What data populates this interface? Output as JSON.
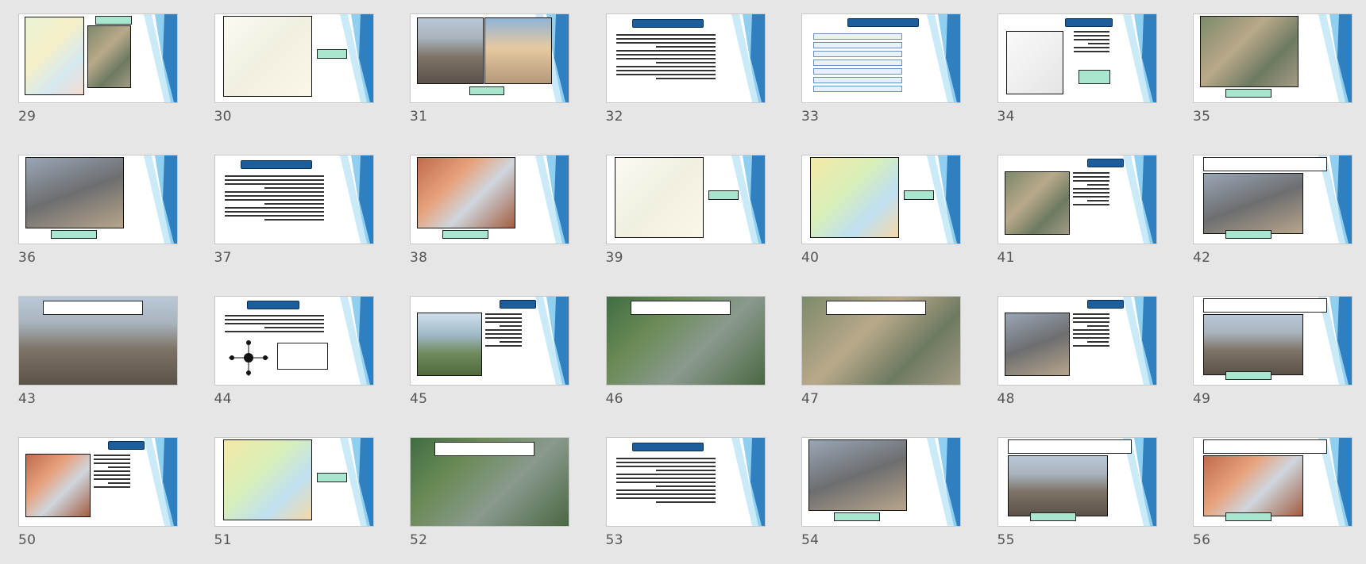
{
  "slides": [
    {
      "number": "29",
      "kind": "map-photo"
    },
    {
      "number": "30",
      "kind": "map"
    },
    {
      "number": "31",
      "kind": "two-photos"
    },
    {
      "number": "32",
      "kind": "text-title"
    },
    {
      "number": "33",
      "kind": "diagram"
    },
    {
      "number": "34",
      "kind": "map-text"
    },
    {
      "number": "35",
      "kind": "photo"
    },
    {
      "number": "36",
      "kind": "photo"
    },
    {
      "number": "37",
      "kind": "text-title"
    },
    {
      "number": "38",
      "kind": "photo"
    },
    {
      "number": "39",
      "kind": "map"
    },
    {
      "number": "40",
      "kind": "map-color"
    },
    {
      "number": "41",
      "kind": "photo-text"
    },
    {
      "number": "42",
      "kind": "photo-caption"
    },
    {
      "number": "43",
      "kind": "full-photo-caption"
    },
    {
      "number": "44",
      "kind": "diagram-text"
    },
    {
      "number": "45",
      "kind": "photo-text"
    },
    {
      "number": "46",
      "kind": "full-photo-caption"
    },
    {
      "number": "47",
      "kind": "full-photo-caption"
    },
    {
      "number": "48",
      "kind": "photo-text"
    },
    {
      "number": "49",
      "kind": "photo-caption"
    },
    {
      "number": "50",
      "kind": "photo-text"
    },
    {
      "number": "51",
      "kind": "map-color"
    },
    {
      "number": "52",
      "kind": "full-photo-caption"
    },
    {
      "number": "53",
      "kind": "text-title"
    },
    {
      "number": "54",
      "kind": "photo"
    },
    {
      "number": "55",
      "kind": "photo-caption"
    },
    {
      "number": "56",
      "kind": "photo-caption"
    }
  ],
  "colors": {
    "background": "#e6e6e6",
    "accent_dark": "#1c5e9c",
    "accent_light": "#8fd0f0",
    "label_green": "#a8e6cf"
  }
}
